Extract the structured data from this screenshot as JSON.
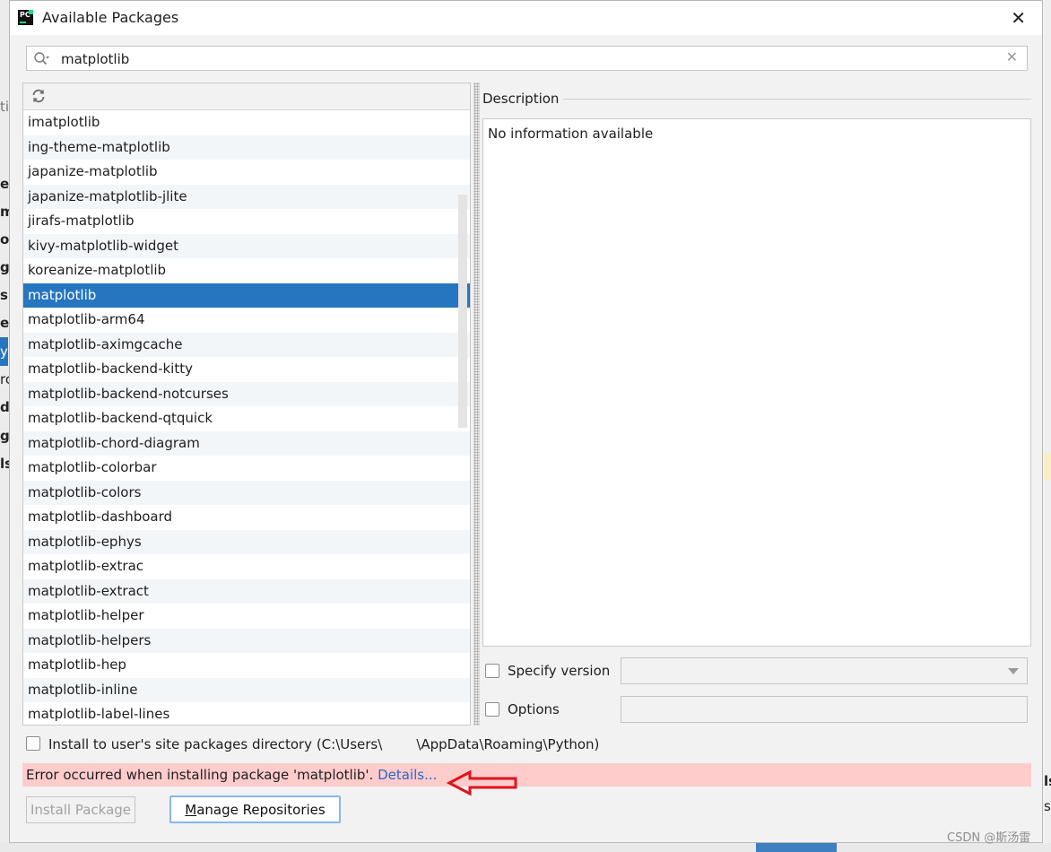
{
  "dialog": {
    "title": "Available Packages",
    "close_icon": "close-icon"
  },
  "search": {
    "value": "matplotlib",
    "placeholder": ""
  },
  "packages": [
    "imatplotlib",
    "ing-theme-matplotlib",
    "japanize-matplotlib",
    "japanize-matplotlib-jlite",
    "jirafs-matplotlib",
    "kivy-matplotlib-widget",
    "koreanize-matplotlib",
    "matplotlib",
    "matplotlib-arm64",
    "matplotlib-aximgcache",
    "matplotlib-backend-kitty",
    "matplotlib-backend-notcurses",
    "matplotlib-backend-qtquick",
    "matplotlib-chord-diagram",
    "matplotlib-colorbar",
    "matplotlib-colors",
    "matplotlib-dashboard",
    "matplotlib-ephys",
    "matplotlib-extrac",
    "matplotlib-extract",
    "matplotlib-helper",
    "matplotlib-helpers",
    "matplotlib-hep",
    "matplotlib-inline",
    "matplotlib-label-lines"
  ],
  "selected_package": "matplotlib",
  "description": {
    "label": "Description",
    "text": "No information available"
  },
  "specify_version": {
    "label": "Specify version",
    "checked": false,
    "value": ""
  },
  "options": {
    "label": "Options",
    "checked": false,
    "value": ""
  },
  "install_to_user": {
    "label": "Install to user's site packages directory (C:\\Users\\",
    "label_suffix": "\\AppData\\Roaming\\Python)",
    "checked": false
  },
  "error": {
    "message": "Error occurred when installing package 'matplotlib'. ",
    "link": "Details..."
  },
  "buttons": {
    "install": "Install Package",
    "manage_mnemonic": "M",
    "manage_rest": "anage Repositories"
  },
  "background": {
    "fragments": [
      "ti",
      "e",
      "m",
      "o",
      "gi",
      "si",
      "e",
      "y",
      "rc",
      "d",
      "g",
      "ls",
      "ls",
      "s"
    ],
    "watermark": "CSDN @斯汤雷"
  },
  "colors": {
    "selection": "#2675bf",
    "error_bg": "#ffcccc",
    "link": "#2a66c7",
    "annotation_arrow": "#e0131b"
  }
}
